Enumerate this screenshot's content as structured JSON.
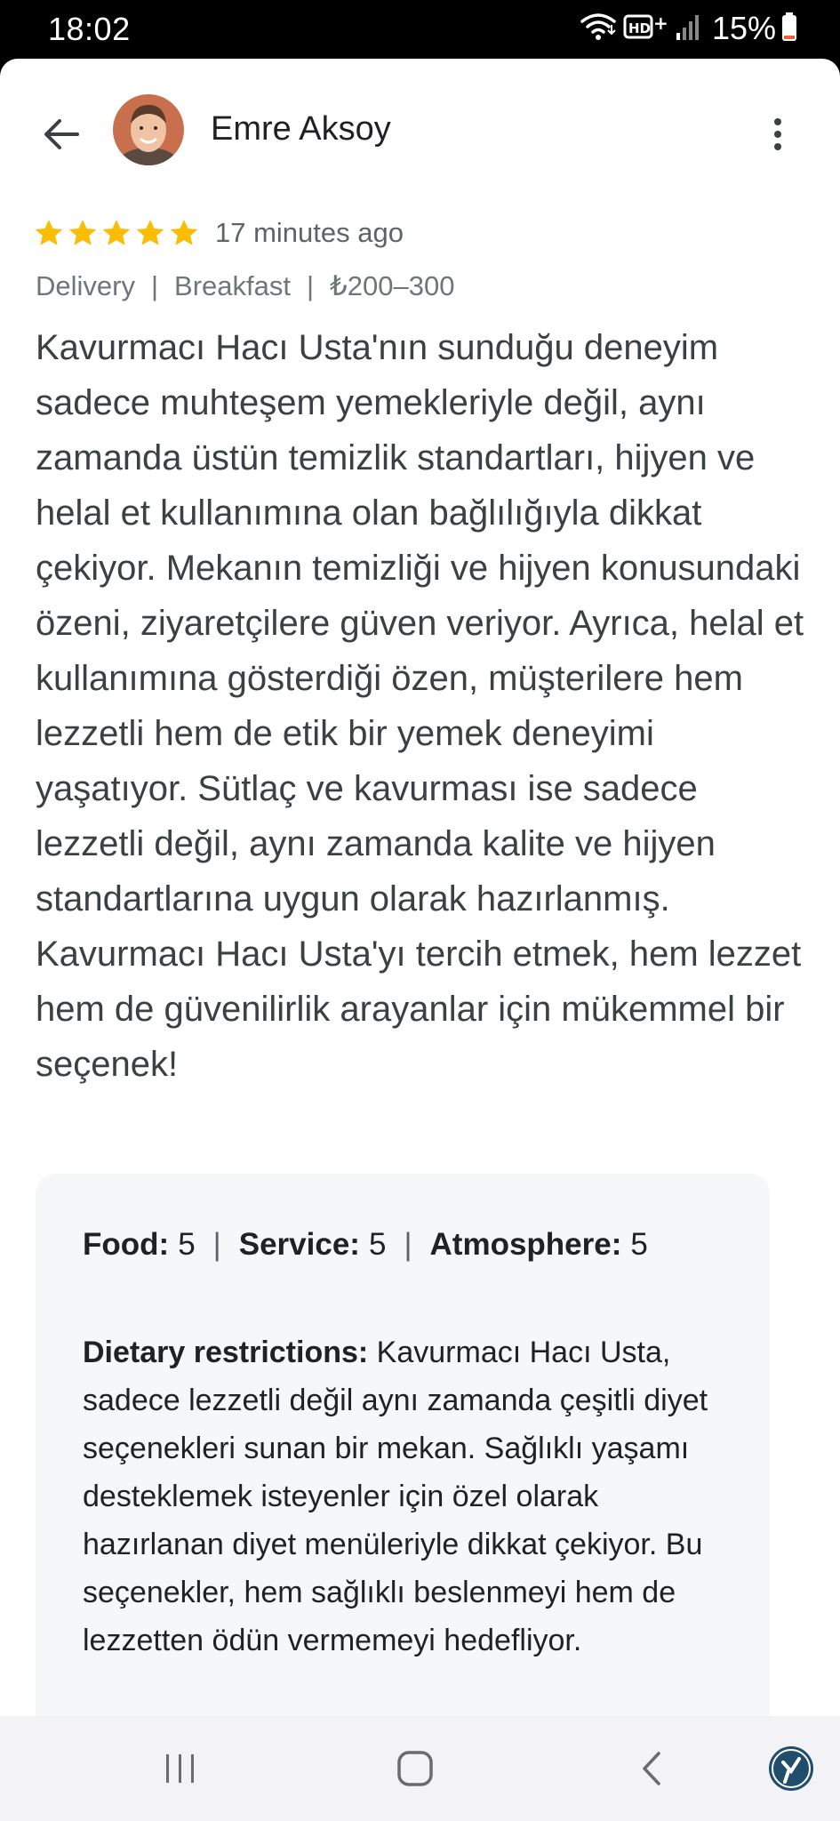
{
  "status_bar": {
    "time": "18:02",
    "battery": "15%"
  },
  "header": {
    "reviewer_name": "Emre Aksoy"
  },
  "review": {
    "stars": 5,
    "time_ago": "17 minutes ago",
    "meta": [
      "Delivery",
      "Breakfast",
      "₺200–300"
    ],
    "text": "Kavurmacı Hacı Usta'nın sunduğu deneyim sadece muhteşem yemekleriyle değil, aynı zamanda üstün temizlik standartları, hijyen ve helal et kullanımına olan bağlılığıyla dikkat çekiyor. Mekanın temizliği ve hijyen konusundaki özeni, ziyaretçilere güven veriyor. Ayrıca, helal et kullanımına gösterdiği özen, müşterilere hem lezzetli hem de etik bir yemek deneyimi yaşatıyor. Sütlaç ve kavurması ise sadece lezzetli değil, aynı zamanda kalite ve hijyen standartlarına uygun olarak hazırlanmış. Kavurmacı Hacı Usta'yı tercih etmek, hem lezzet hem de güvenilirlik arayanlar için mükemmel bir seçenek!"
  },
  "details": {
    "ratings": [
      {
        "label": "Food:",
        "value": "5"
      },
      {
        "label": "Service:",
        "value": "5"
      },
      {
        "label": "Atmosphere:",
        "value": "5"
      }
    ],
    "dietary_label": "Dietary restrictions:",
    "dietary_text": " Kavurmacı Hacı Usta, sadece lezzetli değil aynı zamanda çeşitli diyet seçenekleri sunan bir mekan. Sağlıklı yaşamı desteklemek isteyenler için özel olarak hazırlanan diyet menüleriyle dikkat çekiyor. Bu seçenekler, hem sağlıklı beslenmeyi hem de lezzetten ödün vermemeyi hedefliyor."
  },
  "colors": {
    "star": "#fbbc04",
    "text_primary": "#202124",
    "text_secondary": "#70757a",
    "card_bg": "#f6f7f9",
    "nav_bg": "#f3f3f6"
  },
  "icons": {
    "back": "arrow-back-icon",
    "more": "more-vert-icon",
    "wifi": "wifi-icon",
    "signal": "signal-icon",
    "battery": "battery-icon"
  }
}
